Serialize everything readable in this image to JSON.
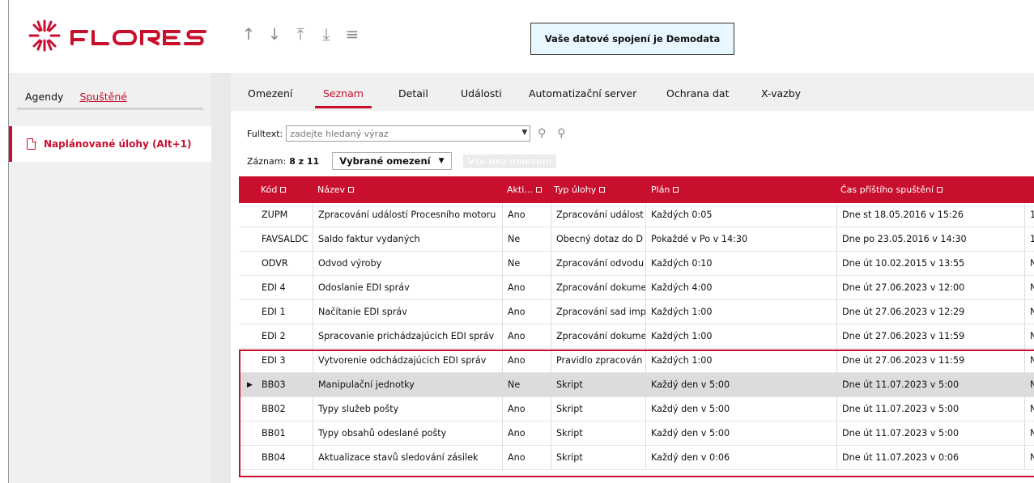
{
  "header": {
    "logo_text": "FLORES",
    "nav_icons": [
      "arrow-up-icon",
      "arrow-down-icon",
      "arrow-to-top-icon",
      "arrow-to-bottom-icon",
      "hamburger-menu-icon"
    ],
    "connection_notice": "Vaše datové spojení je Demodata"
  },
  "left_panel": {
    "tabs": [
      {
        "label": "Agendy",
        "active": false
      },
      {
        "label": "Spuštěné",
        "active": true
      }
    ],
    "items": [
      {
        "label": "Naplánované úlohy (Alt+1)",
        "icon": "document-icon"
      }
    ]
  },
  "main": {
    "tabs": [
      {
        "label": "Omezení",
        "active": false
      },
      {
        "label": "Seznam",
        "active": true
      },
      {
        "label": "Detail",
        "active": false
      },
      {
        "label": "Události",
        "active": false
      },
      {
        "label": "Automatizační server",
        "active": false
      },
      {
        "label": "Ochrana dat",
        "active": false
      },
      {
        "label": "X-vazby",
        "active": false
      }
    ],
    "fulltext_label": "Fulltext:",
    "fulltext_placeholder": "zadejte hledaný výraz",
    "record_label": "Záznam:",
    "record_value": "8 z 11",
    "filter_select": "Vybrané omezení",
    "no_filter": "Vše bez omezení"
  },
  "table": {
    "columns": [
      "Kód",
      "Název",
      "Akti...",
      "Typ úlohy",
      "Plán",
      "Čas příštího spuštění"
    ],
    "rows": [
      {
        "kod": "ZUPM",
        "nazev": "Zpracování událostí Procesního motoru",
        "aktivni": "Ano",
        "typ": "Zpracování událost",
        "plan": "Každých 0:05",
        "cas": "Dne st 18.05.2016 v 15:26",
        "extra": "1"
      },
      {
        "kod": "FAVSALDC",
        "nazev": "Saldo faktur vydaných",
        "aktivni": "Ne",
        "typ": "Obecný dotaz do D",
        "plan": "Pokaždé v Po v 14:30",
        "cas": "Dne po 23.05.2016 v 14:30",
        "extra": "1"
      },
      {
        "kod": "ODVR",
        "nazev": "Odvod výroby",
        "aktivni": "Ne",
        "typ": "Zpracování odvodu",
        "plan": "Každých 0:10",
        "cas": "Dne út 10.02.2015 v 13:55",
        "extra": "N"
      },
      {
        "kod": "EDI 4",
        "nazev": "Odoslanie EDI správ",
        "aktivni": "Ano",
        "typ": "Zpracování dokume",
        "plan": "Každých 4:00",
        "cas": "Dne út 27.06.2023 v 12:00",
        "extra": "N"
      },
      {
        "kod": "EDI 1",
        "nazev": "Načítanie EDI správ",
        "aktivni": "Ano",
        "typ": "Zpracování sad imp",
        "plan": "Každých 1:00",
        "cas": "Dne út 27.06.2023 v 12:29",
        "extra": "N"
      },
      {
        "kod": "EDI 2",
        "nazev": "Spracovanie prichádzajúcich EDI správ",
        "aktivni": "Ano",
        "typ": "Zpracování dokume",
        "plan": "Každých 1:00",
        "cas": "Dne út 27.06.2023 v 11:59",
        "extra": "N"
      },
      {
        "kod": "EDI 3",
        "nazev": "Vytvorenie odchádzajúcich EDI správ",
        "aktivni": "Ano",
        "typ": "Pravidlo zpracován",
        "plan": "Každých 1:00",
        "cas": "Dne út 27.06.2023 v 11:59",
        "extra": "N"
      },
      {
        "kod": "BB03",
        "nazev": "Manipulační jednotky",
        "aktivni": "Ne",
        "typ": "Skript",
        "plan": "Každý den v 5:00",
        "cas": "Dne út 11.07.2023 v 5:00",
        "extra": "N",
        "selected": true
      },
      {
        "kod": "BB02",
        "nazev": "Typy služeb pošty",
        "aktivni": "Ano",
        "typ": "Skript",
        "plan": "Každý den v 5:00",
        "cas": "Dne út 11.07.2023 v 5:00",
        "extra": "N"
      },
      {
        "kod": "BB01",
        "nazev": "Typy obsahů odeslané pošty",
        "aktivni": "Ano",
        "typ": "Skript",
        "plan": "Každý den v 5:00",
        "cas": "Dne út 11.07.2023 v 5:00",
        "extra": "N"
      },
      {
        "kod": "BB04",
        "nazev": "Aktualizace stavů sledování zásilek",
        "aktivni": "Ano",
        "typ": "Skript",
        "plan": "Každý den v 0:06",
        "cas": "Dne út 11.07.2023 v 0:06",
        "extra": "N"
      }
    ]
  },
  "colors": {
    "accent": "#c8102e",
    "notice_bg": "#e8f6ff",
    "selected_row": "#dcdcdc"
  }
}
